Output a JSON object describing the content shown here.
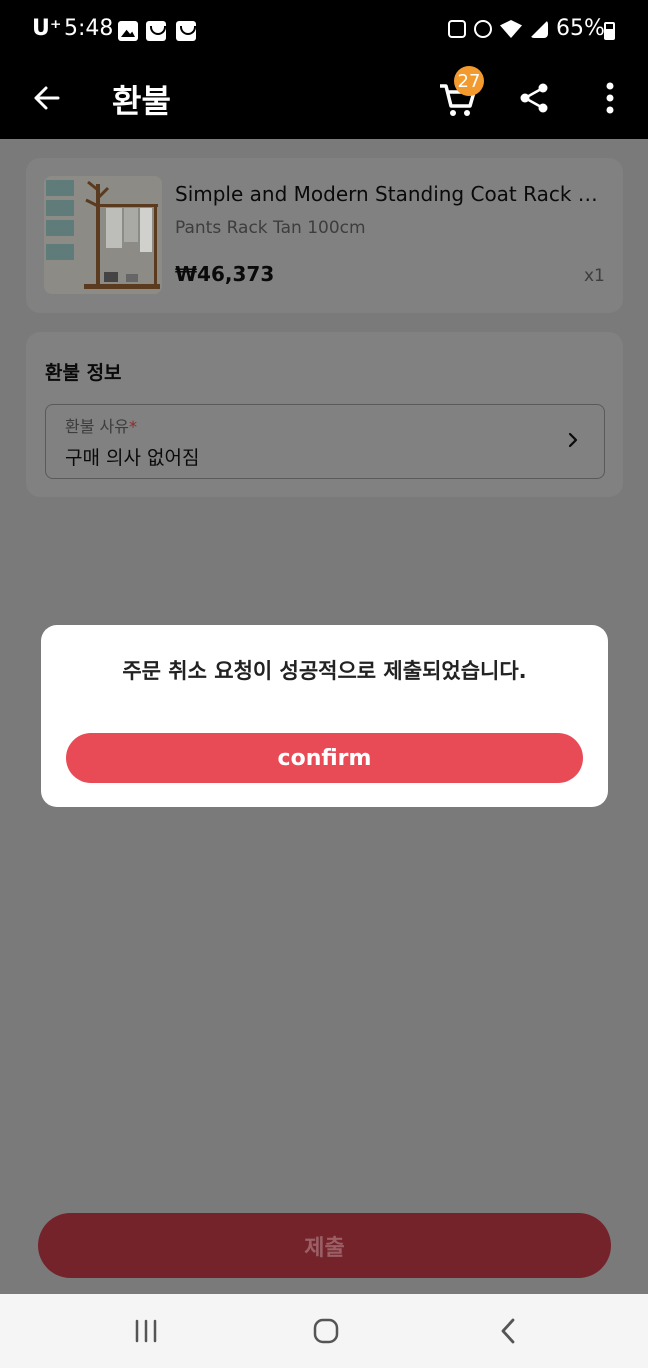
{
  "status_bar": {
    "carrier": "U⁺",
    "time": "5:48",
    "battery": "65%",
    "icons": [
      "gallery-icon",
      "smile-icon",
      "smile-icon",
      "recycle-icon",
      "alarm-icon",
      "wifi-icon",
      "signal-icon",
      "battery-icon"
    ]
  },
  "app_bar": {
    "title": "환불",
    "cart_count": "27",
    "icons": [
      "back-arrow-icon",
      "cart-icon",
      "share-icon",
      "more-vert-icon"
    ]
  },
  "product": {
    "name": "Simple and Modern Standing Coat Rack Hanger",
    "variant": "Pants Rack Tan 100cm",
    "price": "₩46,373",
    "quantity": "x1"
  },
  "refund_info": {
    "section_title": "환불 정보",
    "reason_label": "환불 사유",
    "required_mark": "*",
    "reason_value": "구매 의사 없어짐"
  },
  "submit_label": "제출",
  "dialog": {
    "message": "주문 취소 요청이 성공적으로 제출되었습니다.",
    "confirm_label": "confirm"
  },
  "colors": {
    "accent": "#e94b56",
    "badge": "#f29a2e",
    "overlay": "#7a7a7a"
  }
}
